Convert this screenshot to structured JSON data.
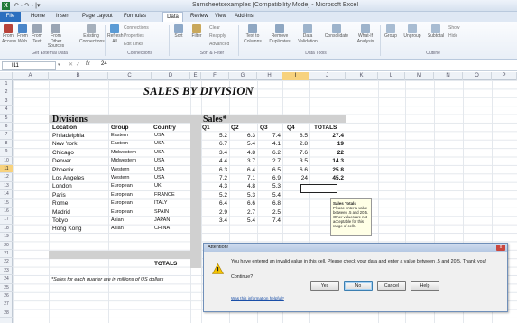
{
  "window": {
    "title": "Sumsheetsexamples  [Compatibility Mode] - Microsoft Excel",
    "app_icon": "X",
    "qat": "↶ · ↷ · |▾"
  },
  "ribbon": {
    "tabs": [
      "File",
      "Home",
      "Insert",
      "Page Layout",
      "Formulas",
      "Data",
      "Review",
      "View",
      "Add-Ins"
    ],
    "active_tab": "Data",
    "groups": [
      "Get External Data",
      "Connections",
      "Sort & Filter",
      "Data Tools",
      "Outline"
    ],
    "buttons": [
      "From Access",
      "From Web",
      "From Text",
      "From Other Sources",
      "Existing Connections",
      "Refresh All",
      "Sort",
      "Filter",
      "Text to Columns",
      "Remove Duplicates",
      "Data Validation",
      "Consolidate",
      "What-If Analysis",
      "Group",
      "Ungroup",
      "Subtotal"
    ],
    "small_buttons": {
      "connections": "Connections",
      "properties": "Properties",
      "edit_links": "Edit Links",
      "clear": "Clear",
      "reapply": "Reapply",
      "advanced": "Advanced",
      "show_detail": "Show",
      "hide_detail": "Hide"
    }
  },
  "formula_bar": {
    "name_box": "I11",
    "fx": "fx",
    "value": "24"
  },
  "columns": [
    "A",
    "B",
    "C",
    "D",
    "E",
    "F",
    "G",
    "H",
    "I",
    "J",
    "K",
    "L",
    "M",
    "N",
    "O",
    "P"
  ],
  "selected_column": "I",
  "rows": [
    "1",
    "2",
    "3",
    "4",
    "5",
    "6",
    "7",
    "8",
    "9",
    "10",
    "11",
    "12",
    "13",
    "14",
    "15",
    "16",
    "17",
    "18",
    "19",
    "20",
    "21",
    "22",
    "23",
    "24",
    "25",
    "26",
    "27",
    "28"
  ],
  "selected_row": "11",
  "sheet": {
    "title": "SALES BY DIVISION",
    "divisions_label": "Divisions",
    "sales_label": "Sales*",
    "headers": [
      "Location",
      "Group",
      "Country",
      "Q1",
      "Q2",
      "Q3",
      "Q4",
      "TOTALS"
    ],
    "rows": [
      [
        "Philadelphia",
        "Eastern",
        "USA",
        "5.2",
        "6.3",
        "7.4",
        "8.5",
        "27.4"
      ],
      [
        "New York",
        "Eastern",
        "USA",
        "6.7",
        "5.4",
        "4.1",
        "2.8",
        "19"
      ],
      [
        "Chicago",
        "Midwestern",
        "USA",
        "3.4",
        "4.8",
        "6.2",
        "7.6",
        "22"
      ],
      [
        "Denver",
        "Midwestern",
        "USA",
        "4.4",
        "3.7",
        "2.7",
        "3.5",
        "14.3"
      ],
      [
        "Phoenix",
        "Western",
        "USA",
        "6.3",
        "6.4",
        "6.5",
        "6.6",
        "25.8"
      ],
      [
        "Los Angeles",
        "Western",
        "USA",
        "7.2",
        "7.1",
        "6.9",
        "24",
        "45.2"
      ],
      [
        "London",
        "European",
        "UK",
        "4.3",
        "4.8",
        "5.3",
        "",
        ""
      ],
      [
        "Paris",
        "European",
        "FRANCE",
        "5.2",
        "5.3",
        "5.4",
        "",
        ""
      ],
      [
        "Rome",
        "European",
        "ITALY",
        "6.4",
        "6.6",
        "6.8",
        "",
        ""
      ],
      [
        "Madrid",
        "European",
        "SPAIN",
        "2.9",
        "2.7",
        "2.5",
        "",
        ""
      ],
      [
        "Tokyo",
        "Asian",
        "JAPAN",
        "3.4",
        "5.4",
        "7.4",
        "",
        ""
      ],
      [
        "Hong Kong",
        "Asian",
        "CHINA",
        "",
        "",
        "",
        "",
        ""
      ]
    ],
    "totals_label": "TOTALS",
    "footnote": "*Sales for each quarter are in millions of US dollars"
  },
  "tooltip": {
    "title": "Sales Totals",
    "text": "Please enter a value between .5 and 20.5. Other values are not acceptable for this range of cells."
  },
  "dialog": {
    "title": "Attention!",
    "message": "You have entered an invalid value in this cell. Please check your data and enter a value between .5 and 20.5. Thank you!",
    "question": "Continue?",
    "buttons": [
      "Yes",
      "No",
      "Cancel",
      "Help"
    ],
    "link": "Was this information helpful?",
    "close": "x"
  },
  "colors": {
    "accent": "#2b6fbf",
    "band": "#d0d0d0",
    "selected_header": "#f7d27e",
    "warning": "#f5c400"
  }
}
